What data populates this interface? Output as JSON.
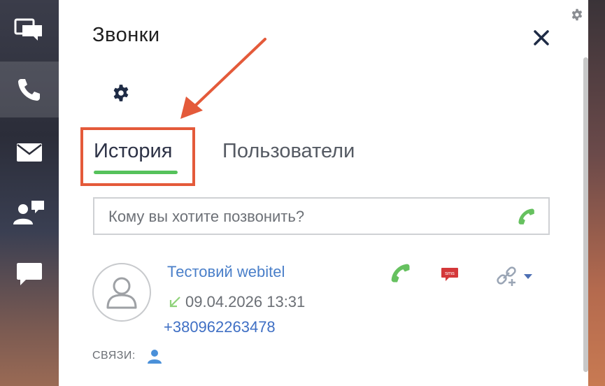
{
  "panel": {
    "title": "Звонки",
    "tabs": [
      {
        "label": "История",
        "active": true
      },
      {
        "label": "Пользователи",
        "active": false
      }
    ],
    "search": {
      "placeholder": "Кому вы хотите позвонить?",
      "value": ""
    }
  },
  "contact": {
    "name": "Тестовий webitel",
    "call_time": "09.04.2026 13:31",
    "phone": "+380962263478",
    "sms_label": "sms",
    "links_label": "СВЯЗИ:"
  },
  "colors": {
    "accent_green": "#55c25b",
    "link_blue": "#4a7fc9",
    "highlight_red": "#e45a3a",
    "dark_navy": "#1e2b45"
  }
}
